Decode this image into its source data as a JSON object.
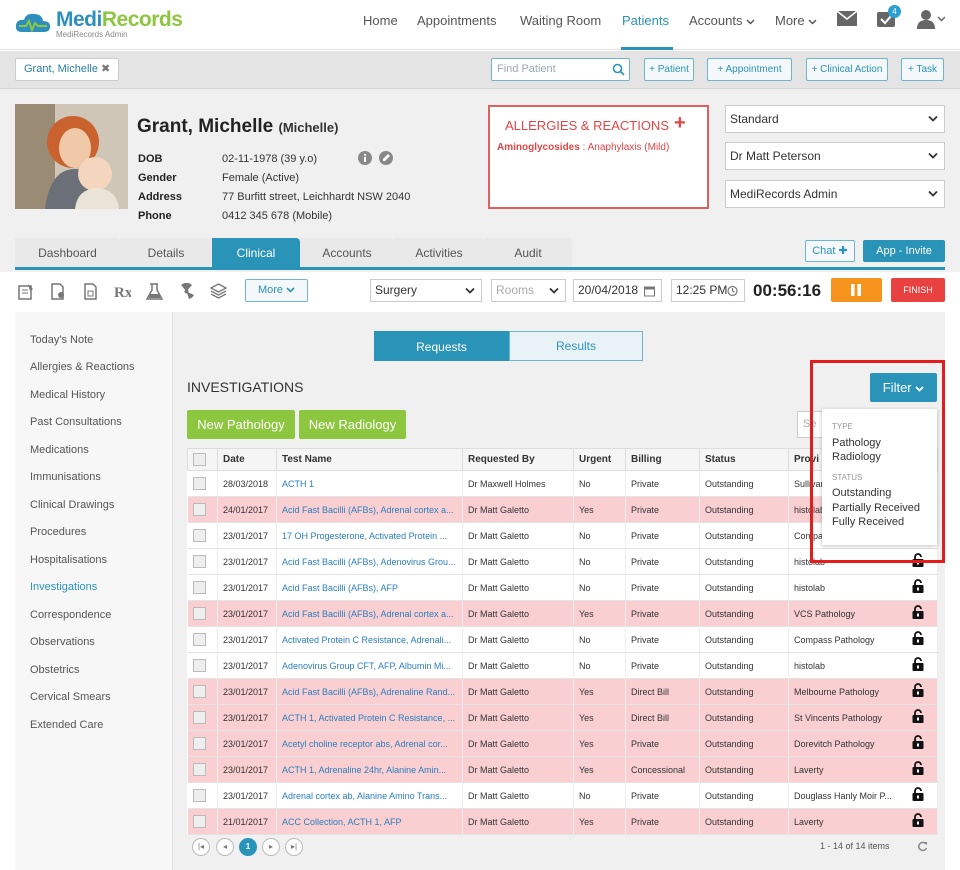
{
  "app": {
    "brand_medi": "Medi",
    "brand_records": "Records",
    "subtitle": "MediRecords Admin"
  },
  "nav": {
    "items": [
      "Home",
      "Appointments",
      "Waiting Room",
      "Patients",
      "Accounts",
      "More"
    ],
    "active": "Patients",
    "tasks_badge": "4"
  },
  "tabbar": {
    "patient_tab": "Grant, Michelle",
    "find_placeholder": "Find Patient",
    "buttons": [
      "+ Patient",
      "+ Appointment",
      "+ Clinical Action",
      "+ Task"
    ]
  },
  "patient": {
    "name": "Grant, Michelle",
    "preferred": "(Michelle)",
    "labels": [
      "DOB",
      "Gender",
      "Address",
      "Phone"
    ],
    "values": [
      "02-11-1978 (39 y.o)",
      "Female (Active)",
      "77 Burfitt street, Leichhardt NSW 2040",
      "0412 345 678 (Mobile)"
    ]
  },
  "allergies": {
    "title": "ALLERGIES & REACTIONS",
    "add": "+",
    "item_name": "Aminoglycosides",
    "item_reaction": " : Anaphylaxis (Mild)"
  },
  "selects": {
    "type": "Standard",
    "doctor": "Dr Matt Peterson",
    "account": "MediRecords Admin"
  },
  "tabs": [
    "Dashboard",
    "Details",
    "Clinical",
    "Accounts",
    "Activities",
    "Audit"
  ],
  "active_tab": "Clinical",
  "actions": {
    "chat": "Chat",
    "invite": "App - Invite"
  },
  "toolbar": {
    "more": "More",
    "location": "Surgery",
    "rooms": "Rooms",
    "date": "20/04/2018",
    "time": "12:25 PM",
    "timer": "00:56:16",
    "finish": "FINISH"
  },
  "sidebar": {
    "items": [
      "Today's Note",
      "Allergies & Reactions",
      "Medical History",
      "Past Consultations",
      "Medications",
      "Immunisations",
      "Clinical Drawings",
      "Procedures",
      "Hospitalisations",
      "Investigations",
      "Correspondence",
      "Observations",
      "Obstetrics",
      "Cervical Smears",
      "Extended Care"
    ],
    "active": "Investigations"
  },
  "main": {
    "seg": [
      "Requests",
      "Results"
    ],
    "title": "INVESTIGATIONS",
    "new_pathology": "New Pathology",
    "new_radiology": "New Radiology",
    "search_placeholder": "Se",
    "filter": "Filter"
  },
  "filter_menu": {
    "group_type": "TYPE",
    "types": [
      "Pathology",
      "Radiology"
    ],
    "group_status": "STATUS",
    "statuses": [
      "Outstanding",
      "Partially Received",
      "Fully Received"
    ]
  },
  "table": {
    "columns": [
      "Date",
      "Test Name",
      "Requested By",
      "Urgent",
      "Billing",
      "Status",
      "Provi"
    ],
    "rows": [
      {
        "date": "28/03/2018",
        "test": "ACTH 1",
        "by": "Dr Maxwell Holmes",
        "urgent": "No",
        "billing": "Private",
        "status": "Outstanding",
        "provider": "Sullivan",
        "hl": false,
        "lock": false
      },
      {
        "date": "24/01/2017",
        "test": "Acid Fast Bacilli (AFBs), Adrenal cortex a...",
        "by": "Dr Matt Galetto",
        "urgent": "Yes",
        "billing": "Private",
        "status": "Outstanding",
        "provider": "histolab",
        "hl": true,
        "lock": false
      },
      {
        "date": "23/01/2017",
        "test": "17 OH Progesterone, Activated Protein ...",
        "by": "Dr Matt Galetto",
        "urgent": "No",
        "billing": "Private",
        "status": "Outstanding",
        "provider": "Compass",
        "hl": false,
        "lock": false
      },
      {
        "date": "23/01/2017",
        "test": "Acid Fast Bacilli (AFBs), Adenovirus Grou...",
        "by": "Dr Matt Galetto",
        "urgent": "No",
        "billing": "Private",
        "status": "Outstanding",
        "provider": "histolab",
        "hl": false,
        "lock": true
      },
      {
        "date": "23/01/2017",
        "test": "Acid Fast Bacilli (AFBs), AFP",
        "by": "Dr Matt Galetto",
        "urgent": "No",
        "billing": "Private",
        "status": "Outstanding",
        "provider": "histolab",
        "hl": false,
        "lock": true
      },
      {
        "date": "23/01/2017",
        "test": "Acid Fast Bacilli (AFBs), Adrenal cortex a...",
        "by": "Dr Matt Galetto",
        "urgent": "Yes",
        "billing": "Private",
        "status": "Outstanding",
        "provider": "VCS Pathology",
        "hl": true,
        "lock": true
      },
      {
        "date": "23/01/2017",
        "test": "Activated Protein C Resistance, Adrenali...",
        "by": "Dr Matt Galetto",
        "urgent": "No",
        "billing": "Private",
        "status": "Outstanding",
        "provider": "Compass Pathology",
        "hl": false,
        "lock": true
      },
      {
        "date": "23/01/2017",
        "test": "Adenovirus Group CFT, AFP, Albumin Mi...",
        "by": "Dr Matt Galetto",
        "urgent": "No",
        "billing": "Private",
        "status": "Outstanding",
        "provider": "histolab",
        "hl": false,
        "lock": true
      },
      {
        "date": "23/01/2017",
        "test": "Acid Fast Bacilli (AFBs), Adrenaline Rand...",
        "by": "Dr Matt Galetto",
        "urgent": "Yes",
        "billing": "Direct Bill",
        "status": "Outstanding",
        "provider": "Melbourne Pathology",
        "hl": true,
        "lock": true
      },
      {
        "date": "23/01/2017",
        "test": "ACTH 1, Activated Protein C Resistance, ...",
        "by": "Dr Matt Galetto",
        "urgent": "Yes",
        "billing": "Direct Bill",
        "status": "Outstanding",
        "provider": "St Vincents Pathology",
        "hl": true,
        "lock": true
      },
      {
        "date": "23/01/2017",
        "test": "Acetyl choline receptor abs, Adrenal cor...",
        "by": "Dr Matt Galetto",
        "urgent": "Yes",
        "billing": "Private",
        "status": "Outstanding",
        "provider": "Dorevitch Pathology",
        "hl": true,
        "lock": true
      },
      {
        "date": "23/01/2017",
        "test": "ACTH 1, Adrenaline 24hr, Alanine Amin...",
        "by": "Dr Matt Galetto",
        "urgent": "Yes",
        "billing": "Concessional",
        "status": "Outstanding",
        "provider": "Laverty",
        "hl": true,
        "lock": true
      },
      {
        "date": "23/01/2017",
        "test": "Adrenal cortex ab, Alanine Amino Trans...",
        "by": "Dr Matt Galetto",
        "urgent": "No",
        "billing": "Private",
        "status": "Outstanding",
        "provider": "Douglass Hanly Moir P...",
        "hl": false,
        "lock": true
      },
      {
        "date": "21/01/2017",
        "test": "ACC Collection, ACTH 1, AFP",
        "by": "Dr Matt Galetto",
        "urgent": "Yes",
        "billing": "Private",
        "status": "Outstanding",
        "provider": "Laverty",
        "hl": true,
        "lock": true
      }
    ]
  },
  "pager": {
    "current": "1",
    "summary": "1 - 14 of 14 items"
  },
  "colors": {
    "primary": "#2a93b8",
    "green": "#8dc63f",
    "urgent_row": "#f9cfd1",
    "pause": "#f7941d",
    "finish": "#e8413f",
    "highlight_box": "#e21d1d"
  }
}
